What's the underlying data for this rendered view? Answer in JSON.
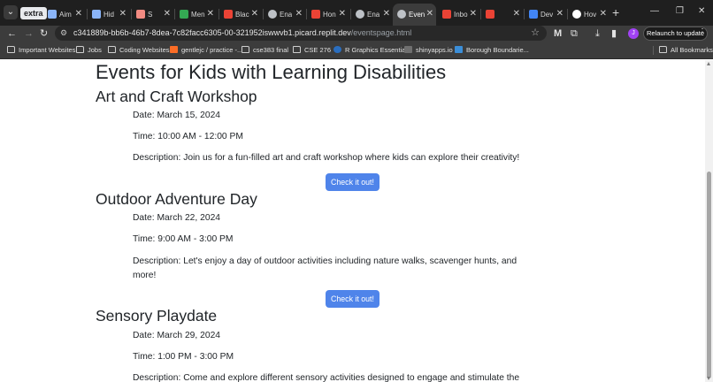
{
  "browser": {
    "tab_group_label": "extra",
    "tabs": [
      {
        "title": "Aim",
        "favicon": "triangle-icon",
        "color": "#8ab4f8"
      },
      {
        "title": "Hid",
        "favicon": "doc-icon",
        "color": "#8ab4f8"
      },
      {
        "title": "S",
        "favicon": "app-icon",
        "color": "#f28b82"
      },
      {
        "title": "Men",
        "favicon": "puzzle-icon",
        "color": "#34a853"
      },
      {
        "title": "Blac",
        "favicon": "flag-icon",
        "color": "#ea4335"
      },
      {
        "title": "Ena",
        "favicon": "globe-icon",
        "color": "#bdc1c6"
      },
      {
        "title": "Hon",
        "favicon": "flag-icon",
        "color": "#ea4335"
      },
      {
        "title": "Ena",
        "favicon": "globe-icon",
        "color": "#bdc1c6"
      },
      {
        "title": "Even",
        "favicon": "globe-icon",
        "color": "#bdc1c6",
        "active": true
      },
      {
        "title": "Inbo",
        "favicon": "gmail-icon",
        "color": "#ea4335"
      },
      {
        "title": "",
        "favicon": "gmail-icon",
        "color": "#ea4335"
      },
      {
        "title": "Dev",
        "favicon": "d-icon",
        "color": "#4285f4"
      },
      {
        "title": "Hov",
        "favicon": "github-icon",
        "color": "#ffffff"
      }
    ],
    "url_host": "c341889b-bb6b-46b7-8dea-7c82facc6305-00-321952iswwvb1.picard.replit.dev",
    "url_path": "/eventspage.html",
    "relaunch_label": "Relaunch to update",
    "profile_initial": "J",
    "bookmarks": [
      {
        "label": "Important Websites",
        "icon": "folder-icon"
      },
      {
        "label": "Jobs",
        "icon": "folder-icon"
      },
      {
        "label": "Coding Websites",
        "icon": "folder-icon"
      },
      {
        "label": "gentlejc / practice -...",
        "icon": "gitlab-icon"
      },
      {
        "label": "cse383 final",
        "icon": "folder-icon"
      },
      {
        "label": "CSE 276",
        "icon": "folder-icon"
      },
      {
        "label": "R Graphics Essential...",
        "icon": "rgraphics-icon"
      },
      {
        "label": "shinyapps.io",
        "icon": "shiny-icon"
      },
      {
        "label": "Borough Boundarie...",
        "icon": "map-icon"
      }
    ],
    "all_bookmarks_label": "All Bookmarks"
  },
  "page": {
    "title": "Events for Kids with Learning Disabilities",
    "accent_color": "#4f84ea",
    "events": [
      {
        "name": "Art and Craft Workshop",
        "date": "Date: March 15, 2024",
        "time": "Time: 10:00 AM - 12:00 PM",
        "description": "Description: Join us for a fun-filled art and craft workshop where kids can explore their creativity!",
        "button": "Check it out!"
      },
      {
        "name": "Outdoor Adventure Day",
        "date": "Date: March 22, 2024",
        "time": "Time: 9:00 AM - 3:00 PM",
        "description": "Description: Let's enjoy a day of outdoor activities including nature walks, scavenger hunts, and more!",
        "button": "Check it out!"
      },
      {
        "name": "Sensory Playdate",
        "date": "Date: March 29, 2024",
        "time": "Time: 1:00 PM - 3:00 PM",
        "description": "Description: Come and explore different sensory activities designed to engage and stimulate the"
      }
    ]
  }
}
